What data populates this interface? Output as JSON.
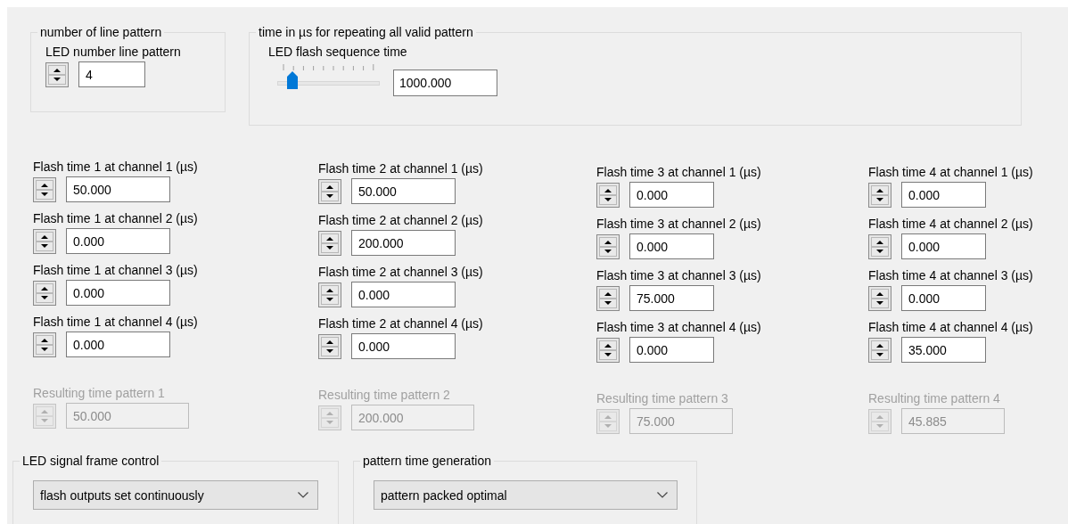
{
  "top_groups": [
    {
      "kind": "spinner",
      "title": "number of line pattern",
      "label": "LED number line pattern",
      "value": "4"
    },
    {
      "kind": "slider",
      "title": "time in µs for repeating all valid pattern",
      "label": "LED flash sequence time",
      "level": 0.1,
      "value": "1000.000"
    }
  ],
  "pattern_columns": [
    {
      "fields": [
        {
          "label": "Flash time 1 at channel 1 (µs)",
          "value": "50.000",
          "disabled": false
        },
        {
          "label": "Flash time 1 at channel 2 (µs)",
          "value": "0.000",
          "disabled": false
        },
        {
          "label": "Flash time 1 at channel 3 (µs)",
          "value": "0.000",
          "disabled": false
        },
        {
          "label": "Flash time 1 at channel 4 (µs)",
          "value": "0.000",
          "disabled": false
        }
      ],
      "result": {
        "label": "Resulting time pattern 1",
        "value": "50.000",
        "disabled": true
      }
    },
    {
      "fields": [
        {
          "label": "Flash time 2 at channel 1 (µs)",
          "value": "50.000",
          "disabled": false
        },
        {
          "label": "Flash time 2 at channel 2 (µs)",
          "value": "200.000",
          "disabled": false
        },
        {
          "label": "Flash time 2 at channel 3 (µs)",
          "value": "0.000",
          "disabled": false
        },
        {
          "label": "Flash time 2 at channel 4 (µs)",
          "value": "0.000",
          "disabled": false
        }
      ],
      "result": {
        "label": "Resulting time pattern 2",
        "value": "200.000",
        "disabled": true
      }
    },
    {
      "fields": [
        {
          "label": "Flash time 3 at channel 1 (µs)",
          "value": "0.000",
          "disabled": false
        },
        {
          "label": "Flash time 3 at channel 2 (µs)",
          "value": "0.000",
          "disabled": false
        },
        {
          "label": "Flash time 3 at channel 3 (µs)",
          "value": "75.000",
          "disabled": false
        },
        {
          "label": "Flash time 3 at channel 4 (µs)",
          "value": "0.000",
          "disabled": false
        }
      ],
      "result": {
        "label": "Resulting time pattern 3",
        "value": "75.000",
        "disabled": true
      }
    },
    {
      "fields": [
        {
          "label": "Flash time 4 at channel 1 (µs)",
          "value": "0.000",
          "disabled": false
        },
        {
          "label": "Flash time 4 at channel 2 (µs)",
          "value": "0.000",
          "disabled": false
        },
        {
          "label": "Flash time 4 at channel 3 (µs)",
          "value": "0.000",
          "disabled": false
        },
        {
          "label": "Flash time 4 at channel 4 (µs)",
          "value": "35.000",
          "disabled": false
        }
      ],
      "result": {
        "label": "Resulting time pattern 4",
        "value": "45.885",
        "disabled": true
      }
    }
  ],
  "bottom_groups": [
    {
      "title": "LED signal frame control",
      "selection": "flash outputs set continuously"
    },
    {
      "title": "pattern time generation",
      "selection": "pattern packed optimal"
    }
  ]
}
